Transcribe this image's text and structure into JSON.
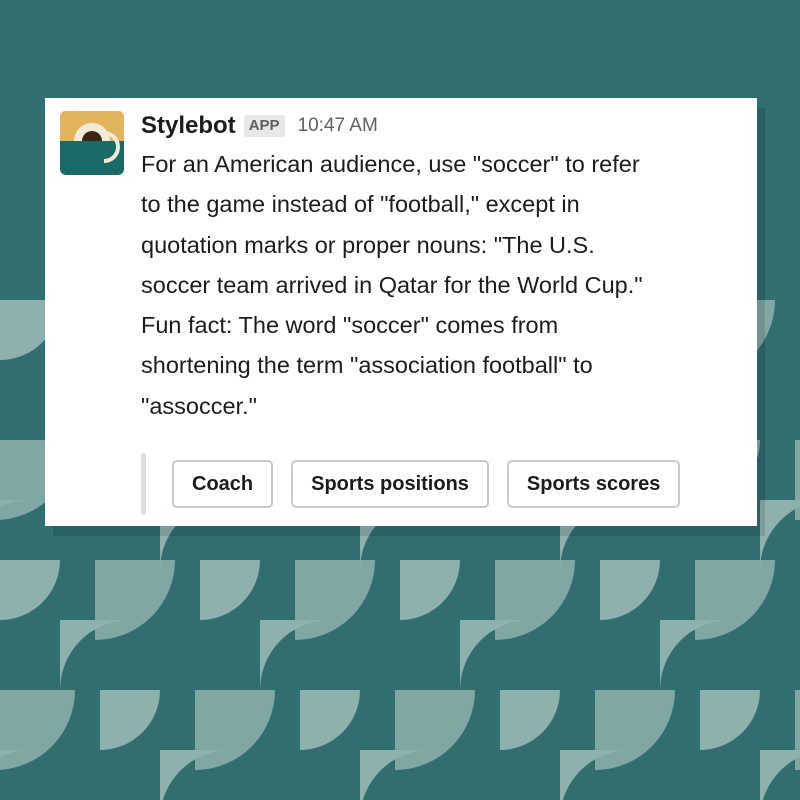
{
  "colors": {
    "background": "#326e70",
    "pattern": "#8fb1ae",
    "card": "#ffffff",
    "avatar_gold": "#e2b45e",
    "avatar_teal": "#1a6b68",
    "avatar_cream": "#f3ead6",
    "avatar_dark": "#3a2418"
  },
  "message": {
    "bot_name": "Stylebot",
    "badge": "APP",
    "timestamp": "10:47 AM",
    "lines": [
      "For an American audience, use \"soccer\" to refer",
      "to the game instead of \"football,\" except in",
      "quotation marks or proper nouns: \"The U.S.",
      "soccer team arrived in Qatar for the World Cup.\"",
      "Fun fact: The word \"soccer\" comes from",
      "shortening the term \"association football\" to",
      "\"assoccer.\""
    ]
  },
  "actions": {
    "buttons": [
      "Coach",
      "Sports positions",
      "Sports scores"
    ]
  }
}
